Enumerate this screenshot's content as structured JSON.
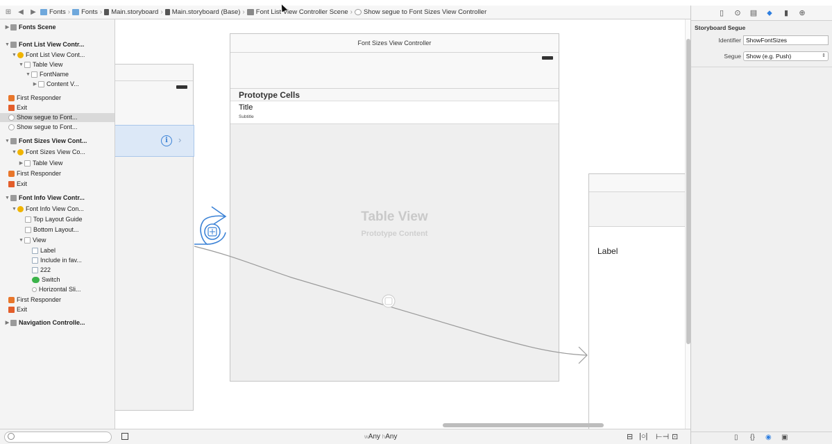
{
  "jumpbar": {
    "crumbs": [
      "Fonts",
      "Fonts",
      "Main.storyboard",
      "Main.storyboard (Base)",
      "Font List View Controller Scene",
      "Show segue to Font Sizes View Controller"
    ]
  },
  "outline": {
    "items": [
      "Fonts Scene",
      "Font List View Contr...",
      "Font List View Cont...",
      "Table View",
      "FontName",
      "Content V...",
      "First Responder",
      "Exit",
      "Show segue to Font...",
      "Show segue to Font...",
      "Font Sizes View Cont...",
      "Font Sizes View Co...",
      "Table View",
      "First Responder",
      "Exit",
      "Font Info View Contr...",
      "Font Info View Con...",
      "Top Layout Guide",
      "Bottom Layout...",
      "View",
      "Label",
      "Include in fav...",
      "222",
      "Switch",
      "Horizontal Sli...",
      "First Responder",
      "Exit",
      "Navigation Controlle..."
    ]
  },
  "canvas": {
    "mid_title": "Font Sizes View Controller",
    "prototype_cells": "Prototype Cells",
    "cell_title": "Title",
    "cell_subtitle": "Subtitle",
    "table_view": "Table View",
    "prototype_content": "Prototype Content",
    "right_label": "Label"
  },
  "bottombar": {
    "size_class_w": "Any",
    "size_class_h": "Any",
    "w_prefix": "w",
    "h_prefix": "h"
  },
  "inspector": {
    "section_title": "Storyboard Segue",
    "identifier_label": "Identifier",
    "identifier_value": "ShowFontSizes",
    "segue_label": "Segue",
    "segue_value": "Show (e.g. Push)"
  },
  "colors": {
    "accent": "#2f7fe0",
    "selection": "#dce8f7",
    "segue_line": "#9a9a9a"
  }
}
